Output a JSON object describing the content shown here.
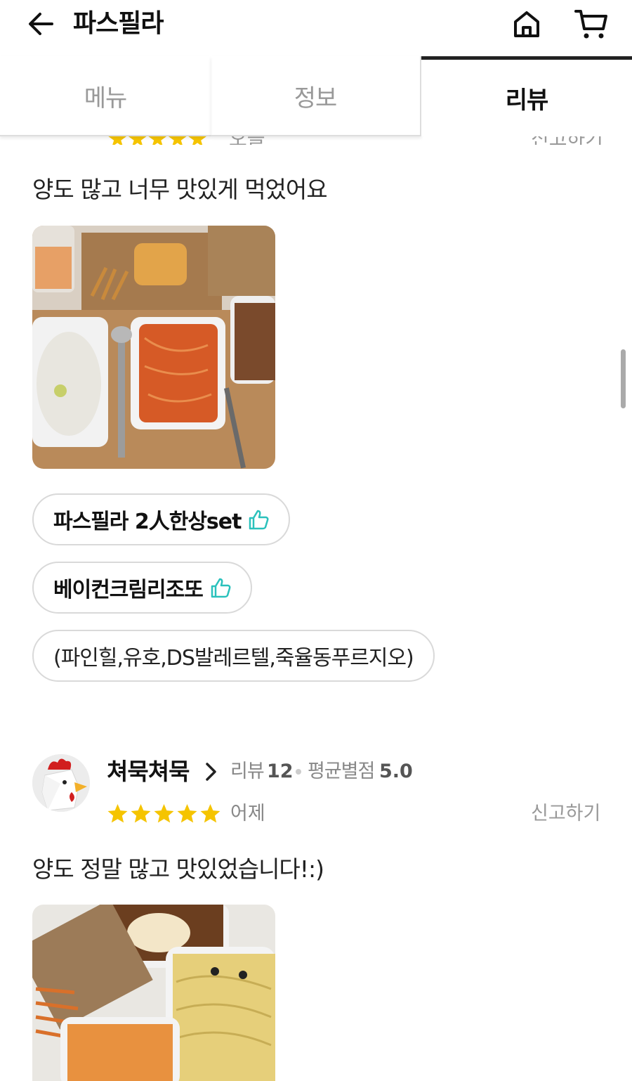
{
  "header": {
    "title": "파스필라",
    "back_icon": "arrow-left-icon",
    "home_icon": "home-icon",
    "cart_icon": "cart-icon"
  },
  "tabs": [
    {
      "label": "메뉴",
      "active": false
    },
    {
      "label": "정보",
      "active": false
    },
    {
      "label": "리뷰",
      "active": true
    }
  ],
  "previous_review_peek": {
    "stars": "★★★★★",
    "date": "오늘",
    "report": "신고하기"
  },
  "reviews": [
    {
      "text": "양도 많고 너무 맛있게 먹었어요",
      "photo": "food-photo",
      "menu_chips": [
        {
          "label": "파스필라 2人한상set",
          "liked": true
        },
        {
          "label": "베이컨크림리조또",
          "liked": true
        },
        {
          "label": "(파인힐,유호,DS발레르텔,죽율동푸르지오)",
          "liked": false
        }
      ]
    },
    {
      "reviewer": {
        "name": "쳐묵쳐묵",
        "avatar_icon": "chicken-avatar-icon",
        "review_count_label": "리뷰",
        "review_count": "12",
        "avg_rating_label": "평균별점",
        "avg_rating": "5.0"
      },
      "rating": 5,
      "date": "어제",
      "report": "신고하기",
      "text": "양도 정말 많고 맛있었습니다!:)",
      "photo": "food-photo"
    }
  ],
  "colors": {
    "star": "#f5c400",
    "thumb": "#2ac1bc",
    "active_tab_bar": "#222222"
  }
}
